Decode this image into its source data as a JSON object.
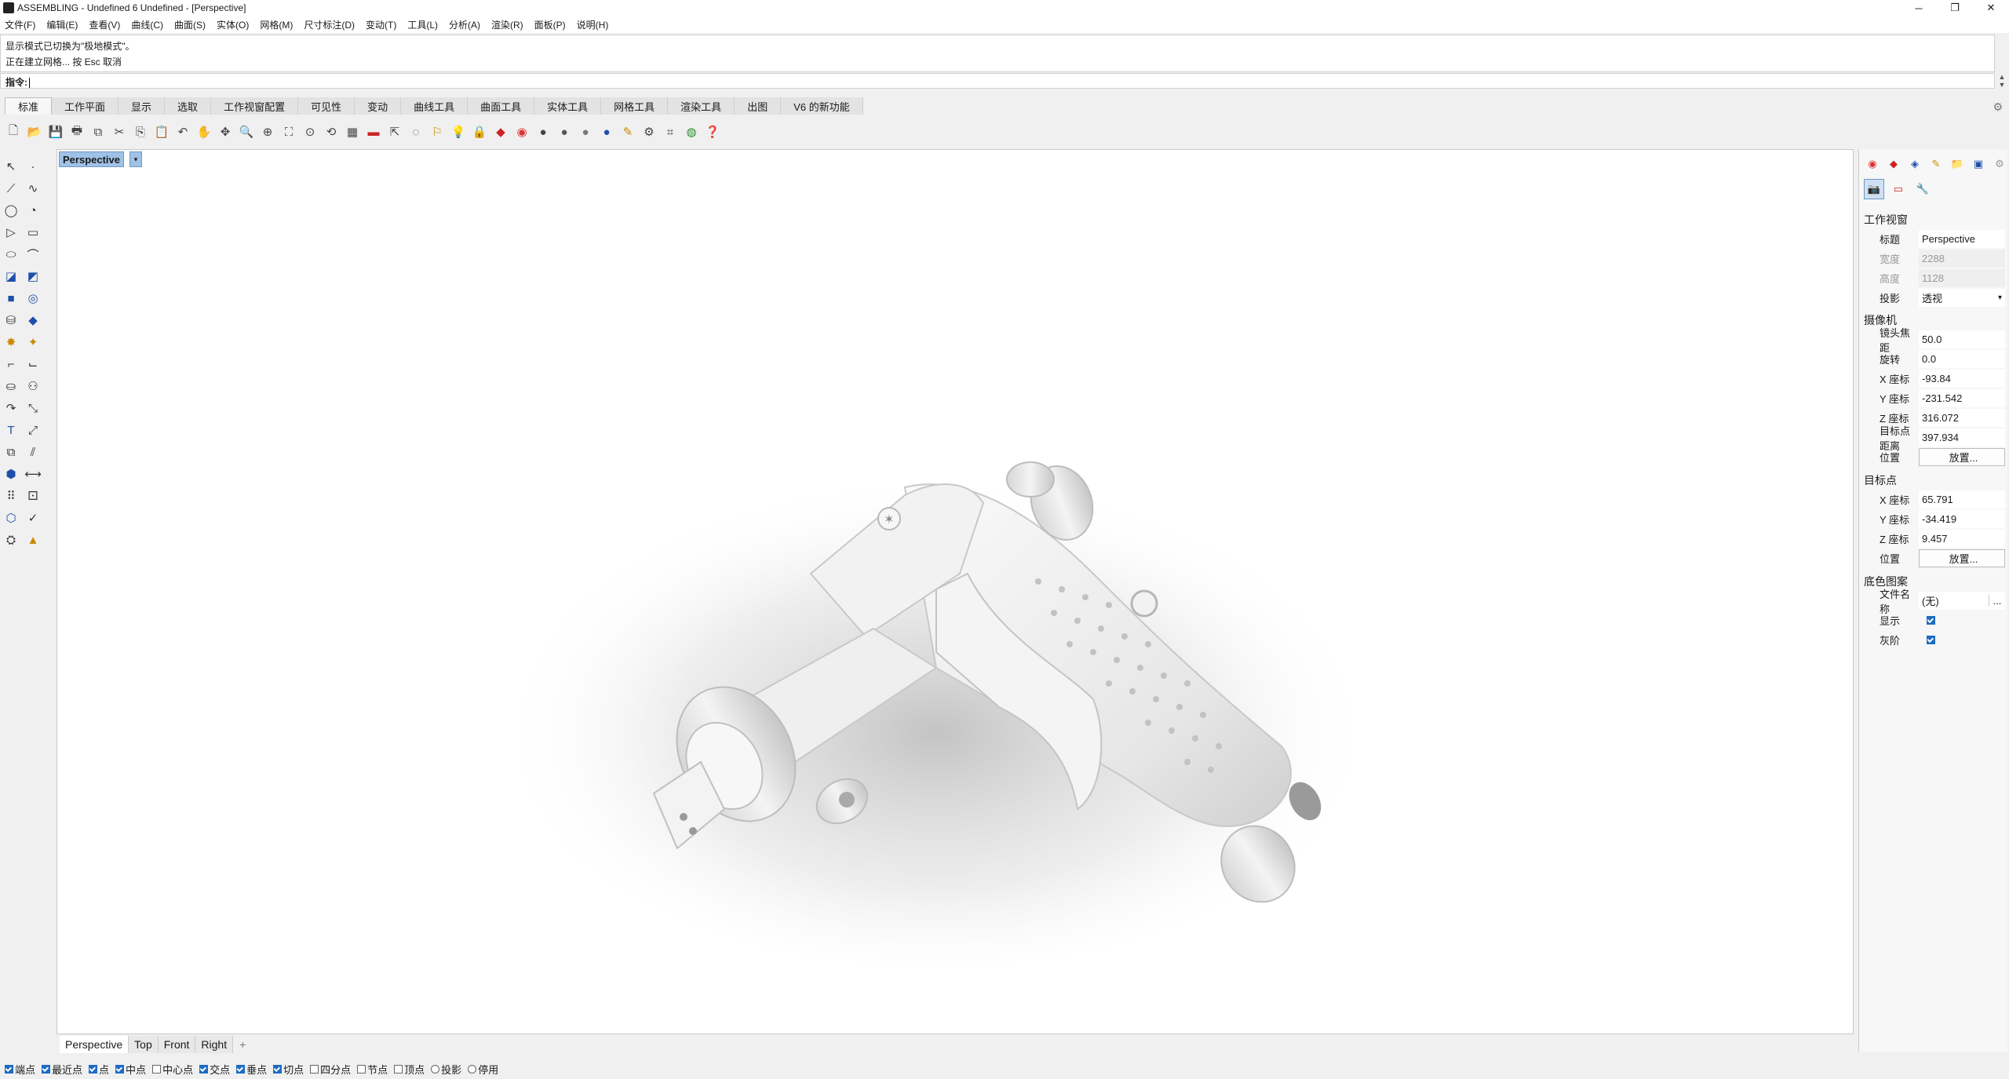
{
  "window": {
    "title": "ASSEMBLING - Undefined 6 Undefined - [Perspective]",
    "minimize": "─",
    "maximize": "❐",
    "close": "✕"
  },
  "menu": [
    "文件(F)",
    "编辑(E)",
    "查看(V)",
    "曲线(C)",
    "曲面(S)",
    "实体(O)",
    "网格(M)",
    "尺寸标注(D)",
    "变动(T)",
    "工具(L)",
    "分析(A)",
    "渲染(R)",
    "面板(P)",
    "说明(H)"
  ],
  "command": {
    "history1": "显示模式已切换为\"极地模式\"。",
    "history2": "正在建立网格... 按 Esc 取消",
    "prompt": "指令:"
  },
  "toolbar_tabs": [
    "标准",
    "工作平面",
    "显示",
    "选取",
    "工作视窗配置",
    "可见性",
    "变动",
    "曲线工具",
    "曲面工具",
    "实体工具",
    "网格工具",
    "渲染工具",
    "出图",
    "V6 的新功能"
  ],
  "viewport": {
    "label": "Perspective",
    "drop": "▾"
  },
  "view_tabs": [
    "Perspective",
    "Top",
    "Front",
    "Right"
  ],
  "view_tab_add": "+",
  "osnaps": [
    {
      "label": "端点",
      "checked": true
    },
    {
      "label": "最近点",
      "checked": true
    },
    {
      "label": "点",
      "checked": true
    },
    {
      "label": "中点",
      "checked": true
    },
    {
      "label": "中心点",
      "checked": false
    },
    {
      "label": "交点",
      "checked": true
    },
    {
      "label": "垂点",
      "checked": true
    },
    {
      "label": "切点",
      "checked": true
    },
    {
      "label": "四分点",
      "checked": false
    },
    {
      "label": "节点",
      "checked": false
    },
    {
      "label": "顶点",
      "checked": false
    }
  ],
  "status_extra": [
    "投影",
    "停用"
  ],
  "props": {
    "section_viewport": "工作视窗",
    "title_label": "标题",
    "title_value": "Perspective",
    "width_label": "宽度",
    "width_value": "2288",
    "height_label": "高度",
    "height_value": "1128",
    "proj_label": "投影",
    "proj_value": "透视",
    "section_camera": "摄像机",
    "lens_label": "镜头焦距",
    "lens_value": "50.0",
    "rot_label": "旋转",
    "rot_value": "0.0",
    "camx_label": "X 座标",
    "camx_value": "-93.84",
    "camy_label": "Y 座标",
    "camy_value": "-231.542",
    "camz_label": "Z 座标",
    "camz_value": "316.072",
    "dist_label": "目标点距离",
    "dist_value": "397.934",
    "pos_label": "位置",
    "place_btn": "放置...",
    "section_target": "目标点",
    "tx_label": "X 座标",
    "tx_value": "65.791",
    "ty_label": "Y 座标",
    "ty_value": "-34.419",
    "tz_label": "Z 座标",
    "tz_value": "9.457",
    "tpos_label": "位置",
    "tplace_btn": "放置...",
    "section_bg": "底色图案",
    "file_label": "文件名称",
    "file_value": "(无)",
    "file_btn": "...",
    "show_label": "显示",
    "gray_label": "灰阶"
  },
  "colors": {
    "accent": "#1e6bc4",
    "viewport_label_bg": "#9fc2e6"
  }
}
